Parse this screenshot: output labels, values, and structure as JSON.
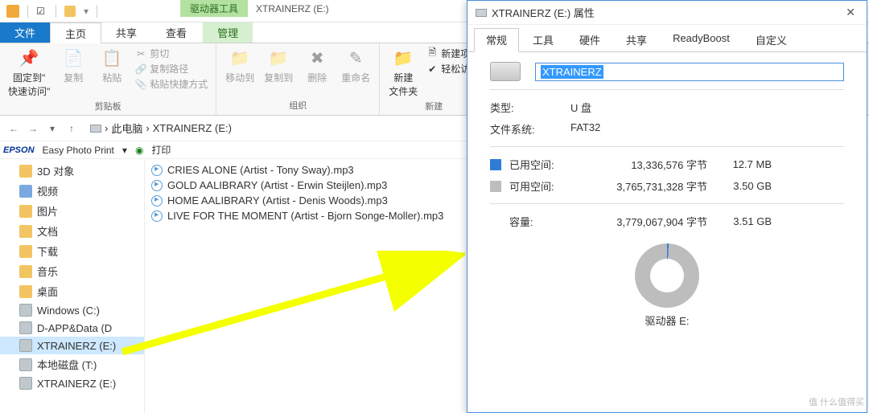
{
  "titlebar": {
    "context_tab": "驱动器工具",
    "window_title": "XTRAINERZ (E:)"
  },
  "ribbon_tabs": {
    "file": "文件",
    "home": "主页",
    "share": "共享",
    "view": "查看",
    "manage": "管理"
  },
  "ribbon": {
    "pin": "固定到\"\n快速访问\"",
    "copy": "复制",
    "paste": "粘贴",
    "cut": "剪切",
    "copy_path": "复制路径",
    "paste_shortcut": "粘贴快捷方式",
    "group_clipboard": "剪贴板",
    "move_to": "移动到",
    "copy_to": "复制到",
    "delete": "删除",
    "rename": "重命名",
    "group_organize": "组织",
    "new_folder": "新建\n文件夹",
    "new_item": "新建项目",
    "easy_access": "轻松访问",
    "group_new": "新建"
  },
  "breadcrumb": {
    "root": "此电脑",
    "current": "XTRAINERZ (E:)"
  },
  "epson": {
    "label": "Easy Photo Print",
    "print": "打印"
  },
  "tree": [
    {
      "label": "3D 对象",
      "type": "folder"
    },
    {
      "label": "视频",
      "type": "video"
    },
    {
      "label": "图片",
      "type": "folder"
    },
    {
      "label": "文档",
      "type": "folder"
    },
    {
      "label": "下载",
      "type": "folder"
    },
    {
      "label": "音乐",
      "type": "folder"
    },
    {
      "label": "桌面",
      "type": "folder"
    },
    {
      "label": "Windows (C:)",
      "type": "drive"
    },
    {
      "label": "D-APP&Data (D",
      "type": "drive"
    },
    {
      "label": "XTRAINERZ (E:)",
      "type": "drive",
      "selected": true
    },
    {
      "label": "本地磁盘 (T:)",
      "type": "drive"
    },
    {
      "label": "XTRAINERZ (E:)",
      "type": "drive"
    }
  ],
  "files": [
    {
      "name": "CRIES ALONE (Artist - Tony Sway).mp3"
    },
    {
      "name": "GOLD AALIBRARY (Artist - Erwin Steijlen).mp3"
    },
    {
      "name": "HOME AALIBRARY (Artist - Denis Woods).mp3"
    },
    {
      "name": "LIVE FOR THE MOMENT (Artist - Bjorn Songe-Moller).mp3"
    }
  ],
  "dialog": {
    "title": "XTRAINERZ (E:) 属性",
    "tabs": {
      "general": "常规",
      "tools": "工具",
      "hardware": "硬件",
      "sharing": "共享",
      "readyboost": "ReadyBoost",
      "custom": "自定义"
    },
    "name_value": "XTRAINERZ",
    "type_label": "类型:",
    "type_value": "U 盘",
    "fs_label": "文件系统:",
    "fs_value": "FAT32",
    "used_label": "已用空间:",
    "used_bytes": "13,336,576 字节",
    "used_h": "12.7 MB",
    "free_label": "可用空间:",
    "free_bytes": "3,765,731,328 字节",
    "free_h": "3.50 GB",
    "cap_label": "容量:",
    "cap_bytes": "3,779,067,904 字节",
    "cap_h": "3.51 GB",
    "drive_label": "驱动器 E:"
  },
  "watermark": "值  什么值得买"
}
